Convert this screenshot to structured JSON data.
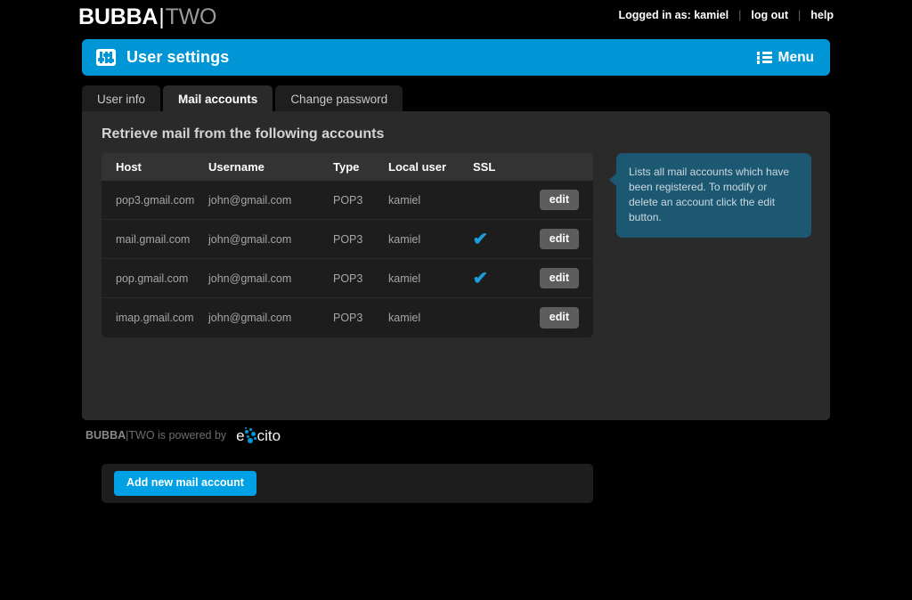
{
  "branding": {
    "logo_primary": "BUBBA",
    "logo_divider": "|",
    "logo_secondary": "TWO",
    "accent_color": "#0096d6",
    "panel_color": "#2a2a2a",
    "page_background": "#000000"
  },
  "topbar": {
    "logged_in_text": "Logged in as: kamiel",
    "separator": "|",
    "logout_label": "log out",
    "help_label": "help"
  },
  "header": {
    "icon": "sliders-icon",
    "title": "User settings",
    "menu_icon": "list-menu-icon",
    "menu_label": "Menu"
  },
  "tabs": [
    {
      "label": "User info",
      "active": false
    },
    {
      "label": "Mail accounts",
      "active": true
    },
    {
      "label": "Change password",
      "active": false
    }
  ],
  "main": {
    "section_title": "Retrieve mail from the following accounts",
    "table": {
      "columns": [
        "Host",
        "Username",
        "Type",
        "Local user",
        "SSL"
      ],
      "action_label": "edit",
      "ssl_check_glyph": "✔",
      "ssl_check_color": "#1a9ede",
      "rows": [
        {
          "host": "pop3.gmail.com",
          "username": "john@gmail.com",
          "type": "POP3",
          "local_user": "kamiel",
          "ssl": false,
          "action": "edit"
        },
        {
          "host": "mail.gmail.com",
          "username": "john@gmail.com",
          "type": "POP3",
          "local_user": "kamiel",
          "ssl": true,
          "action": "edit"
        },
        {
          "host": "pop.gmail.com",
          "username": "john@gmail.com",
          "type": "POP3",
          "local_user": "kamiel",
          "ssl": true,
          "action": "edit"
        },
        {
          "host": "imap.gmail.com",
          "username": "john@gmail.com",
          "type": "POP3",
          "local_user": "kamiel",
          "ssl": false,
          "action": "edit"
        }
      ]
    },
    "add_button_label": "Add new mail account"
  },
  "tooltip": {
    "text": "Lists all mail accounts which have been registered. To modify or delete an account click the edit button.",
    "background_color": "#1d5873"
  },
  "footer": {
    "powered_prefix_bold": "BUBBA",
    "powered_divider": "|",
    "powered_text": "TWO is powered by",
    "vendor_e": "e",
    "vendor_rest": "cito",
    "vendor_name": "excito"
  }
}
